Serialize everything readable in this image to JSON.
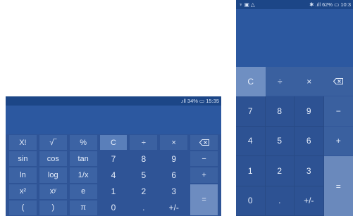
{
  "landscape": {
    "status_time": "15:35",
    "battery": "34%",
    "keys": [
      {
        "label": "X!",
        "kind": "fn"
      },
      {
        "label": "√‾",
        "kind": "fn"
      },
      {
        "label": "%",
        "kind": "fn"
      },
      {
        "label": "C",
        "kind": "c"
      },
      {
        "label": "÷",
        "kind": "op"
      },
      {
        "label": "×",
        "kind": "op"
      },
      {
        "label": "",
        "kind": "op",
        "icon": "backspace-icon"
      },
      {
        "label": "sin",
        "kind": "fn"
      },
      {
        "label": "cos",
        "kind": "fn"
      },
      {
        "label": "tan",
        "kind": "fn"
      },
      {
        "label": "7",
        "kind": "num"
      },
      {
        "label": "8",
        "kind": "num"
      },
      {
        "label": "9",
        "kind": "num"
      },
      {
        "label": "−",
        "kind": "op"
      },
      {
        "label": "ln",
        "kind": "fn"
      },
      {
        "label": "log",
        "kind": "fn"
      },
      {
        "label": "1/x",
        "kind": "fn"
      },
      {
        "label": "4",
        "kind": "num"
      },
      {
        "label": "5",
        "kind": "num"
      },
      {
        "label": "6",
        "kind": "num"
      },
      {
        "label": "+",
        "kind": "op"
      },
      {
        "label": "x²",
        "kind": "fn"
      },
      {
        "label": "xʸ",
        "kind": "fn"
      },
      {
        "label": "e",
        "kind": "fn"
      },
      {
        "label": "1",
        "kind": "num"
      },
      {
        "label": "2",
        "kind": "num"
      },
      {
        "label": "3",
        "kind": "num"
      },
      {
        "label": "=",
        "kind": "eq"
      },
      {
        "label": "(",
        "kind": "fn"
      },
      {
        "label": ")",
        "kind": "fn"
      },
      {
        "label": "π",
        "kind": "fn"
      },
      {
        "label": "0",
        "kind": "num"
      },
      {
        "label": ".",
        "kind": "num"
      },
      {
        "label": "+/-",
        "kind": "num"
      }
    ]
  },
  "portrait": {
    "status_time": "10:3",
    "battery": "62%",
    "keys": [
      {
        "label": "C",
        "kind": "c"
      },
      {
        "label": "÷",
        "kind": "op"
      },
      {
        "label": "×",
        "kind": "op"
      },
      {
        "label": "",
        "kind": "op",
        "icon": "backspace-icon"
      },
      {
        "label": "7",
        "kind": "num"
      },
      {
        "label": "8",
        "kind": "num"
      },
      {
        "label": "9",
        "kind": "num"
      },
      {
        "label": "−",
        "kind": "op"
      },
      {
        "label": "4",
        "kind": "num"
      },
      {
        "label": "5",
        "kind": "num"
      },
      {
        "label": "6",
        "kind": "num"
      },
      {
        "label": "+",
        "kind": "op"
      },
      {
        "label": "1",
        "kind": "num"
      },
      {
        "label": "2",
        "kind": "num"
      },
      {
        "label": "3",
        "kind": "num"
      },
      {
        "label": "=",
        "kind": "eq"
      },
      {
        "label": "0",
        "kind": "num"
      },
      {
        "label": ".",
        "kind": "num"
      },
      {
        "label": "+/-",
        "kind": "num"
      }
    ]
  }
}
